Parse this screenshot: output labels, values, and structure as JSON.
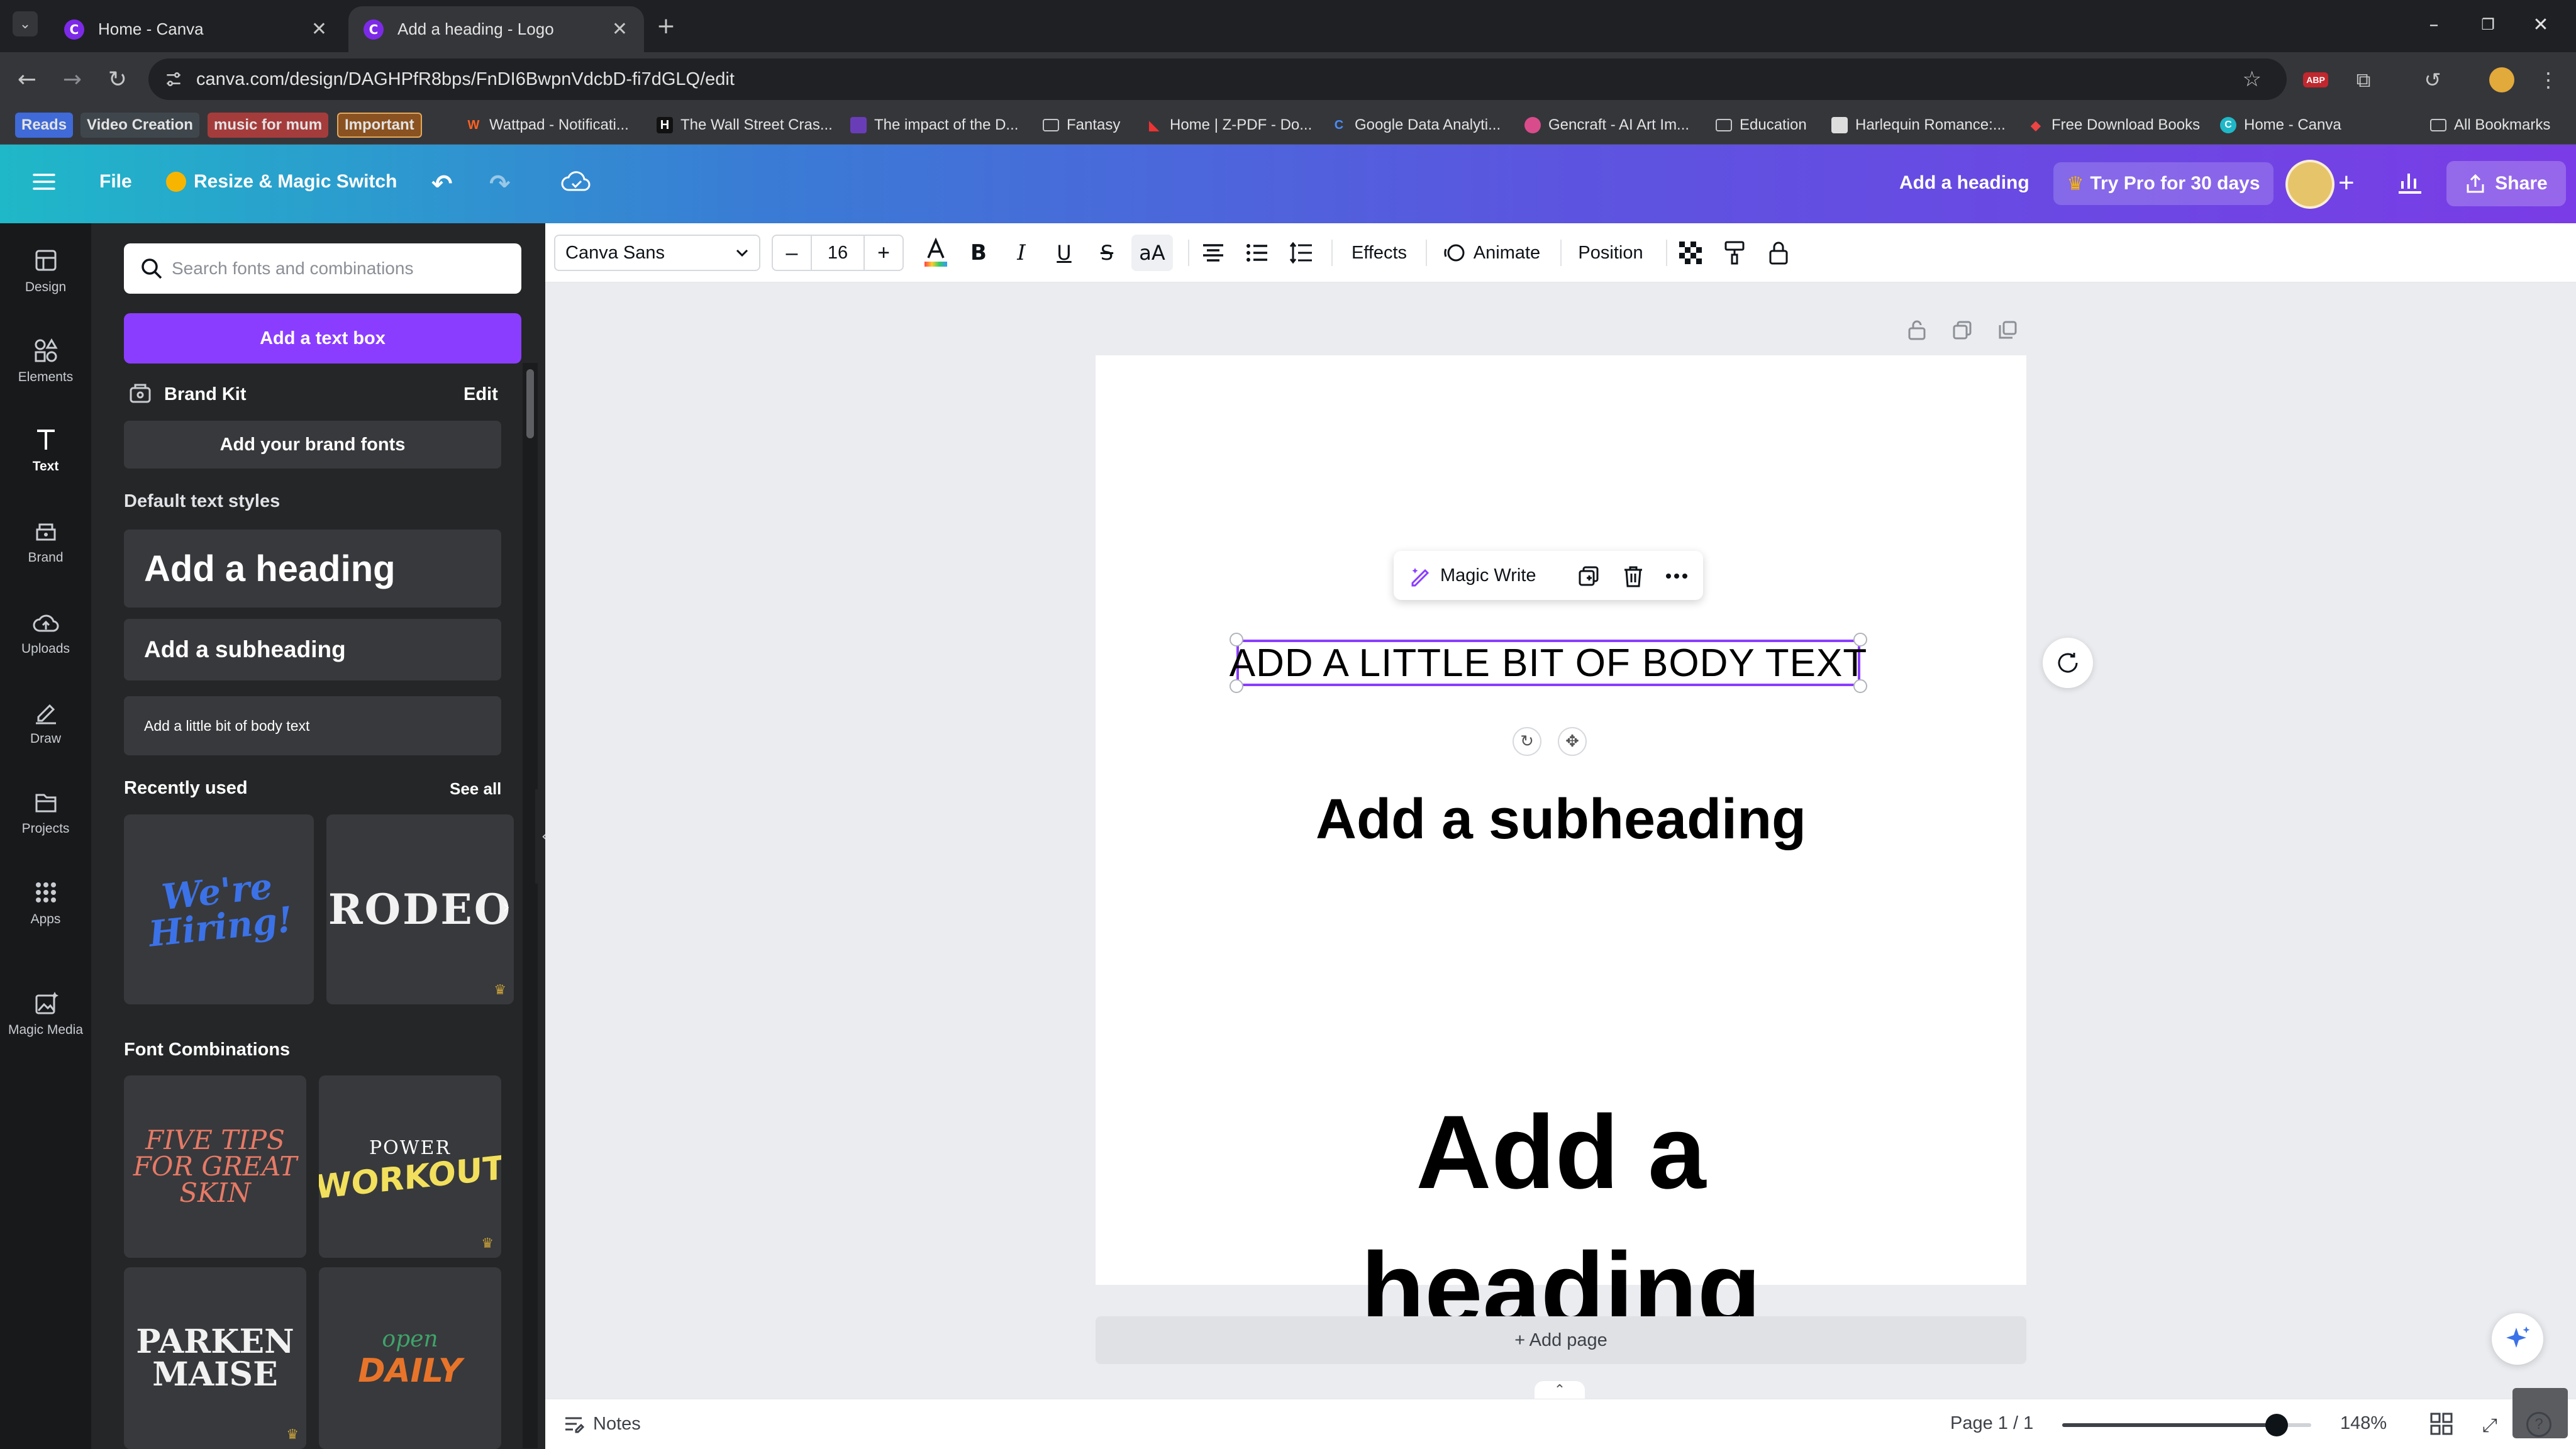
{
  "browser": {
    "tabs": [
      {
        "title": "Home - Canva"
      },
      {
        "title": "Add a heading - Logo"
      }
    ],
    "url": "canva.com/design/DAGHPfR8bps/FnDI6BwpnVdcbD-fi7dGLQ/edit",
    "bookmarks": [
      "Reads",
      "Video Creation",
      "music for mum",
      "Important",
      "Wattpad - Notificati...",
      "The Wall Street Cras...",
      "The impact of the D...",
      "Fantasy",
      "Home | Z-PDF - Do...",
      "Google Data Analyti...",
      "Gencraft - AI Art Im...",
      "Education",
      "Harlequin Romance:...",
      "Free Download Books",
      "Home - Canva",
      "All Bookmarks"
    ]
  },
  "header": {
    "file": "File",
    "resize": "Resize & Magic Switch",
    "design_title": "Add a heading",
    "try_pro": "Try Pro for 30 days",
    "share": "Share"
  },
  "rail": [
    {
      "label": "Design",
      "icon": "design-icon"
    },
    {
      "label": "Elements",
      "icon": "elements-icon"
    },
    {
      "label": "Text",
      "icon": "text-icon"
    },
    {
      "label": "Brand",
      "icon": "brand-icon"
    },
    {
      "label": "Uploads",
      "icon": "uploads-icon"
    },
    {
      "label": "Draw",
      "icon": "draw-icon"
    },
    {
      "label": "Projects",
      "icon": "projects-icon"
    },
    {
      "label": "Apps",
      "icon": "apps-icon"
    },
    {
      "label": "Magic Media",
      "icon": "magic-media-icon"
    }
  ],
  "panel": {
    "search_placeholder": "Search fonts and combinations",
    "add_text_box": "Add a text box",
    "brand_kit": "Brand Kit",
    "edit": "Edit",
    "add_brand_fonts": "Add your brand fonts",
    "default_styles": "Default text styles",
    "add_heading": "Add a heading",
    "add_subheading": "Add a subheading",
    "add_body": "Add a little bit of body text",
    "recently_used": "Recently used",
    "see_all": "See all",
    "recent": [
      "We're Hiring!",
      "RODEO"
    ],
    "font_combinations": "Font Combinations",
    "combos": [
      {
        "line1": "FIVE TIPS",
        "line2": "FOR GREAT",
        "line3": "SKIN"
      },
      {
        "top": "POWER",
        "main": "WORKOUT"
      },
      {
        "line1": "PARKEN",
        "line2": "MAISE"
      },
      {
        "top": "open",
        "main": "DAILY"
      }
    ]
  },
  "toolbar": {
    "font": "Canva Sans",
    "font_size": "16",
    "effects": "Effects",
    "animate": "Animate",
    "position": "Position"
  },
  "canvas": {
    "magic_write": "Magic Write",
    "body_text": "ADD A LITTLE BIT OF BODY TEXT",
    "subheading": "Add a subheading",
    "heading_line1": "Add a",
    "heading_line2": "heading",
    "add_page": "+ Add page"
  },
  "bottom": {
    "notes": "Notes",
    "page": "Page 1 / 1",
    "zoom": "148%",
    "zoom_fraction": 0.86
  },
  "colors": {
    "accent": "#8b3dff",
    "rail_bg": "#18191b",
    "panel_bg": "#252627"
  }
}
